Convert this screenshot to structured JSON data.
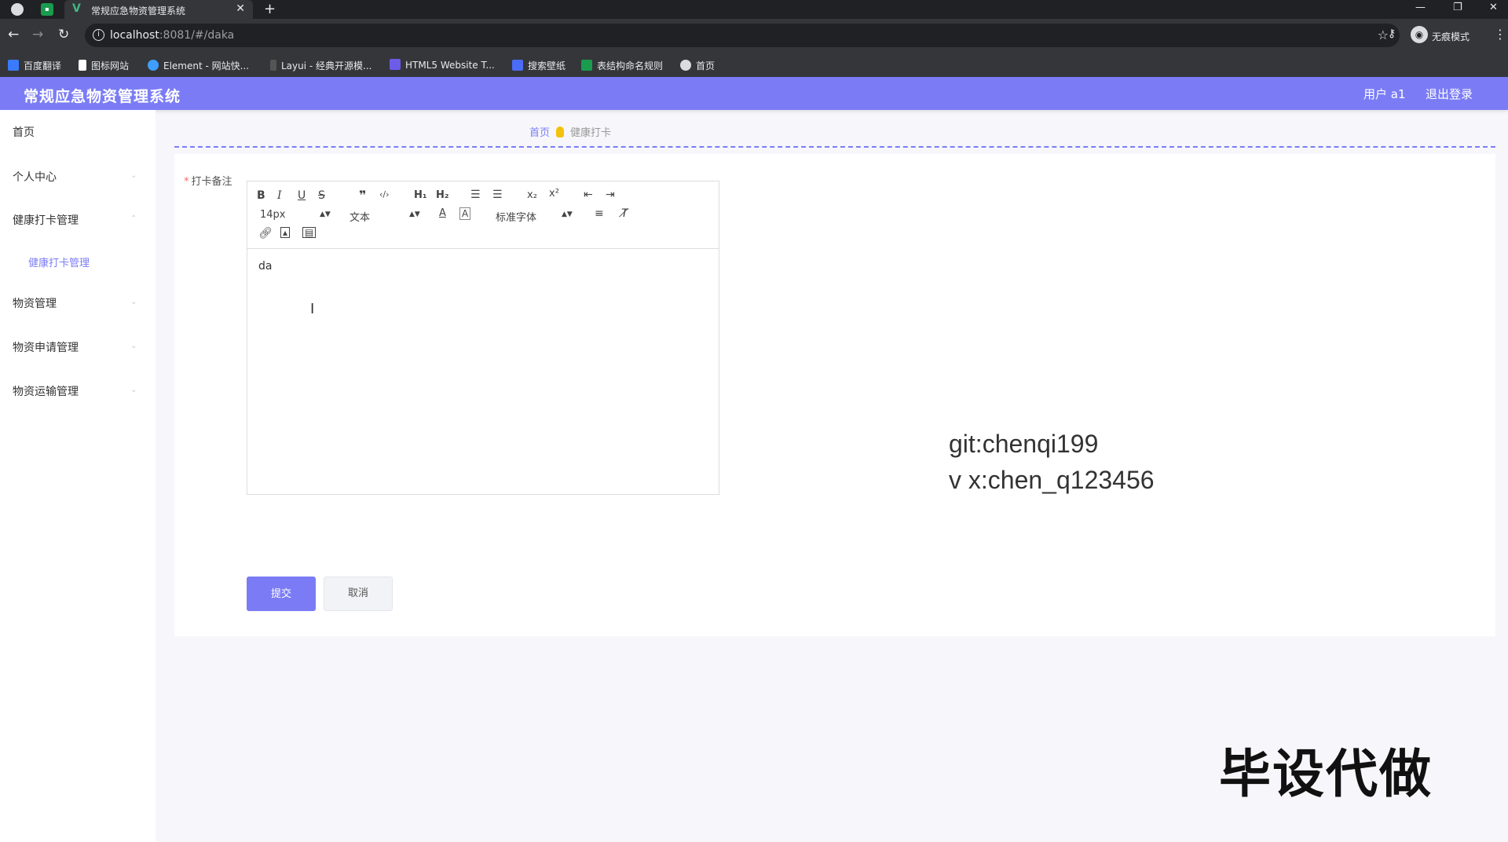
{
  "browser": {
    "tab_title": "常规应急物资管理系统",
    "url_host": "localhost",
    "url_rest": ":8081/#/daka",
    "incognito_label": "无痕模式",
    "bookmarks": [
      {
        "label": "百度翻译",
        "color": "#3a7afe"
      },
      {
        "label": "图标网站",
        "color": "#ffffff"
      },
      {
        "label": "Element - 网站快...",
        "color": "#409eff"
      },
      {
        "label": "Layui - 经典开源模...",
        "color": "#cccccc"
      },
      {
        "label": "HTML5 Website T...",
        "color": "#6c5ce7"
      },
      {
        "label": "搜索壁纸",
        "color": "#4a6cf7"
      },
      {
        "label": "表结构命名规则",
        "color": "#1a9c4f"
      },
      {
        "label": "首页",
        "color": "#dadce0"
      }
    ]
  },
  "header": {
    "title": "常规应急物资管理系统",
    "user": "用户 a1",
    "logout": "退出登录",
    "color": "#7b7cf5"
  },
  "sidebar": {
    "items": [
      {
        "label": "首页"
      },
      {
        "label": "个人中心"
      },
      {
        "label": "健康打卡管理"
      },
      {
        "label": "健康打卡管理",
        "sub": true
      },
      {
        "label": "物资管理"
      },
      {
        "label": "物资申请管理"
      },
      {
        "label": "物资运输管理"
      }
    ]
  },
  "breadcrumb": {
    "home": "首页",
    "current": "健康打卡"
  },
  "form": {
    "field_label": "打卡备注",
    "editor": {
      "font_size": "14px",
      "block_type": "文本",
      "font_family": "标准字体",
      "content": "da"
    },
    "submit": "提交",
    "cancel": "取消"
  },
  "overlay": {
    "line1": "git:chenqi199",
    "line2": "v x:chen_q123456",
    "watermark": "毕设代做"
  }
}
